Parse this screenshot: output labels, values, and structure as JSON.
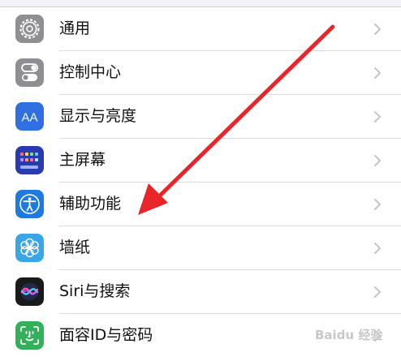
{
  "settings": {
    "items": [
      {
        "label": "通用",
        "icon": "gear-icon",
        "color": "#8e8e93"
      },
      {
        "label": "控制中心",
        "icon": "toggle-switches-icon",
        "color": "#8e8e93"
      },
      {
        "label": "显示与亮度",
        "icon": "text-size-aa-icon",
        "color": "#2f6fe0"
      },
      {
        "label": "主屏幕",
        "icon": "app-grid-icon",
        "color": "#2a3bb0"
      },
      {
        "label": "辅助功能",
        "icon": "accessibility-person-icon",
        "color": "#1f7ae0"
      },
      {
        "label": "墙纸",
        "icon": "flower-icon",
        "color": "#39a6e6"
      },
      {
        "label": "Siri与搜索",
        "icon": "siri-orb-icon",
        "color": "#1a1a1a"
      },
      {
        "label": "面容ID与密码",
        "icon": "face-id-icon",
        "color": "#33b05a"
      }
    ]
  },
  "annotation": {
    "arrow_color": "#e8262a",
    "target": "辅助功能"
  },
  "watermark": "Baidu 经验"
}
